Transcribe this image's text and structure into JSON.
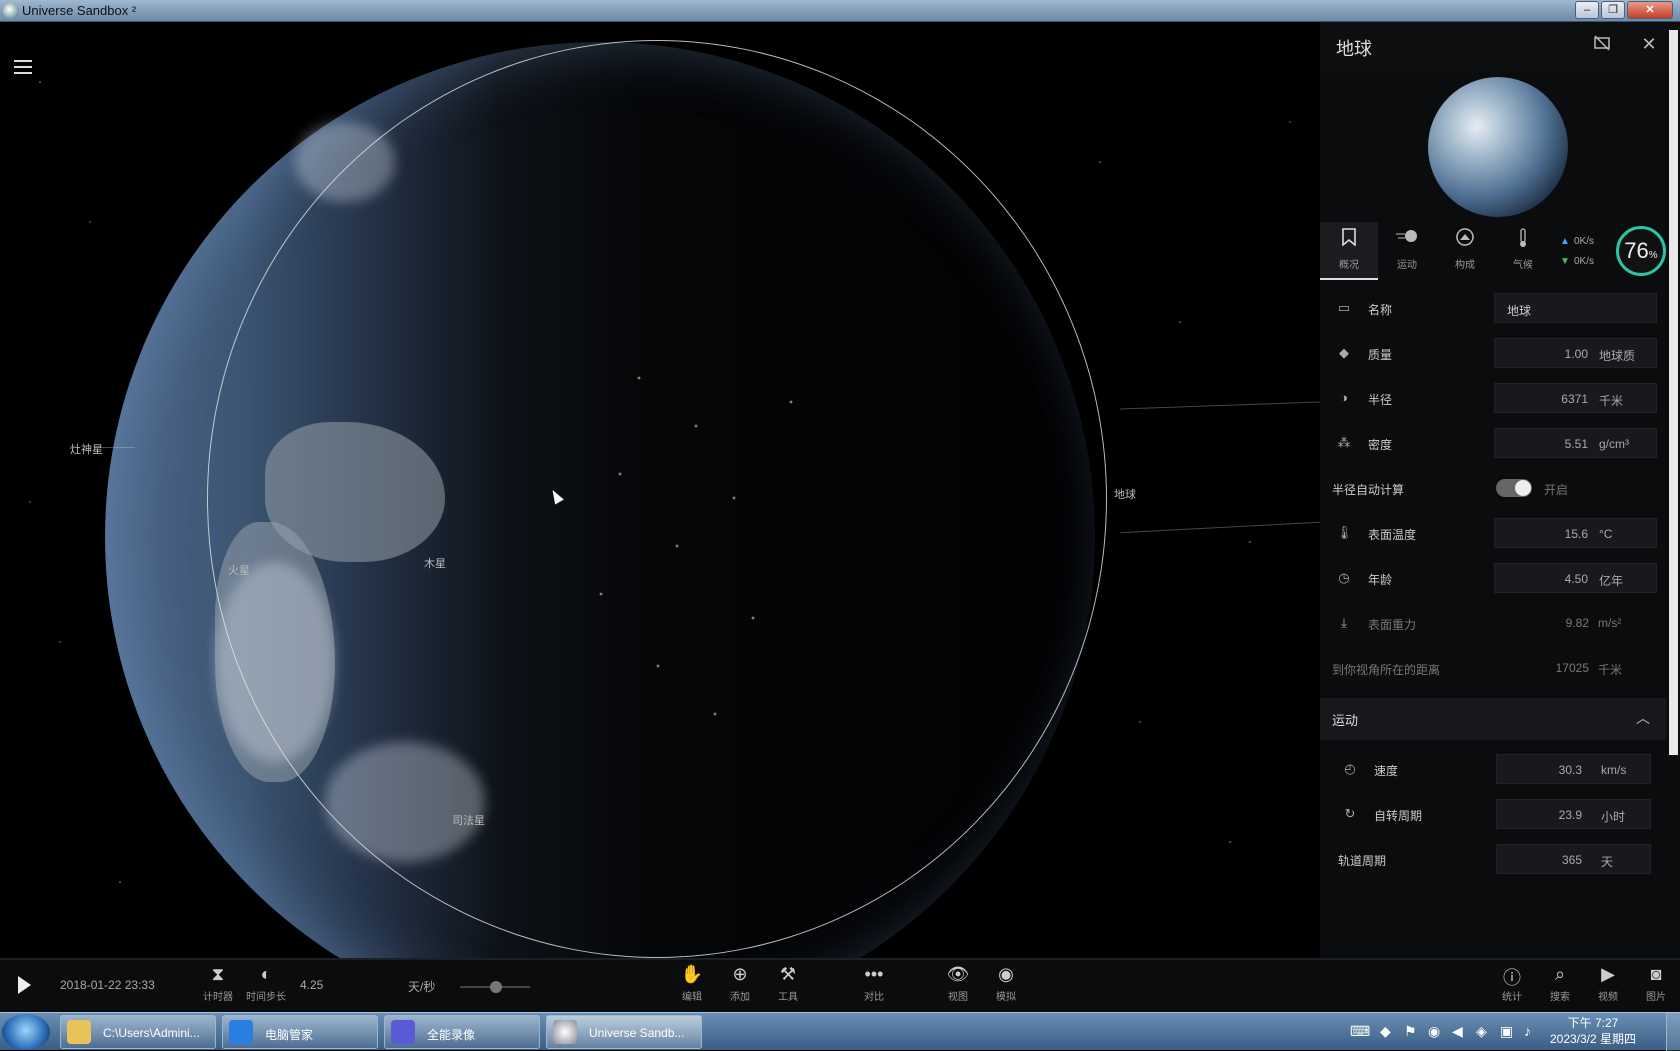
{
  "window": {
    "title": "Universe Sandbox ²",
    "buttons": {
      "minimize": "–",
      "restore": "❐",
      "close": "✕"
    }
  },
  "scene": {
    "labels": {
      "saturn": "灶神星",
      "mars": "火星",
      "jupiter": "木星",
      "earth": "地球",
      "ceres": "司法星"
    }
  },
  "panel": {
    "title": "地球",
    "tabs": [
      {
        "label": "概况",
        "icon": "bookmark"
      },
      {
        "label": "运动",
        "icon": "motion"
      },
      {
        "label": "构成",
        "icon": "composition"
      },
      {
        "label": "气候",
        "icon": "thermometer"
      }
    ],
    "net": {
      "up": "0K/s",
      "down": "0K/s"
    },
    "gauge": {
      "value": "76",
      "unit": "%"
    },
    "props": {
      "name": {
        "label": "名称",
        "value": "地球"
      },
      "mass": {
        "label": "质量",
        "value": "1.00",
        "unit": "地球质"
      },
      "radius": {
        "label": "半径",
        "value": "6371",
        "unit": "千米"
      },
      "density": {
        "label": "密度",
        "value": "5.51",
        "unit": "g/cm³"
      },
      "auto_radius": {
        "label": "半径自动计算",
        "state": "开启"
      },
      "surface_temp": {
        "label": "表面温度",
        "value": "15.6",
        "unit": "°C"
      },
      "age": {
        "label": "年龄",
        "value": "4.50",
        "unit": "亿年"
      },
      "gravity": {
        "label": "表面重力",
        "value": "9.82",
        "unit": "m/s²"
      },
      "distance": {
        "label": "到你视角所在的距离",
        "value": "17025",
        "unit": "千米"
      }
    },
    "motion_section": {
      "title": "运动",
      "speed": {
        "label": "速度",
        "value": "30.3",
        "unit": "km/s"
      },
      "rotation": {
        "label": "自转周期",
        "value": "23.9",
        "unit": "小时"
      },
      "orbit": {
        "label": "轨道周期",
        "value": "365",
        "unit": "天"
      }
    }
  },
  "bottombar": {
    "datetime": "2018-01-22 23:33",
    "timer_label": "计时器",
    "timestep_label": "时间步长",
    "timestep_value": "4.25",
    "rate_unit": "天/秒",
    "tools": [
      {
        "label": "编辑",
        "icon": "hand"
      },
      {
        "label": "添加",
        "icon": "plus-circle"
      },
      {
        "label": "工具",
        "icon": "tool"
      },
      {
        "label": "对比",
        "icon": "compare"
      },
      {
        "label": "视图",
        "icon": "eye"
      },
      {
        "label": "模拟",
        "icon": "simulate"
      }
    ],
    "right_tools": [
      {
        "label": "统计",
        "icon": "info"
      },
      {
        "label": "搜索",
        "icon": "search"
      },
      {
        "label": "视频",
        "icon": "video"
      },
      {
        "label": "图片",
        "icon": "camera"
      }
    ]
  },
  "taskbar": {
    "tasks": [
      {
        "name": "C:\\Users\\Admini..."
      },
      {
        "name": "电脑管家"
      },
      {
        "name": "全能录像"
      },
      {
        "name": "Universe Sandb..."
      }
    ],
    "clock_time": "下午 7:27",
    "clock_date": "2023/3/2 星期四"
  }
}
